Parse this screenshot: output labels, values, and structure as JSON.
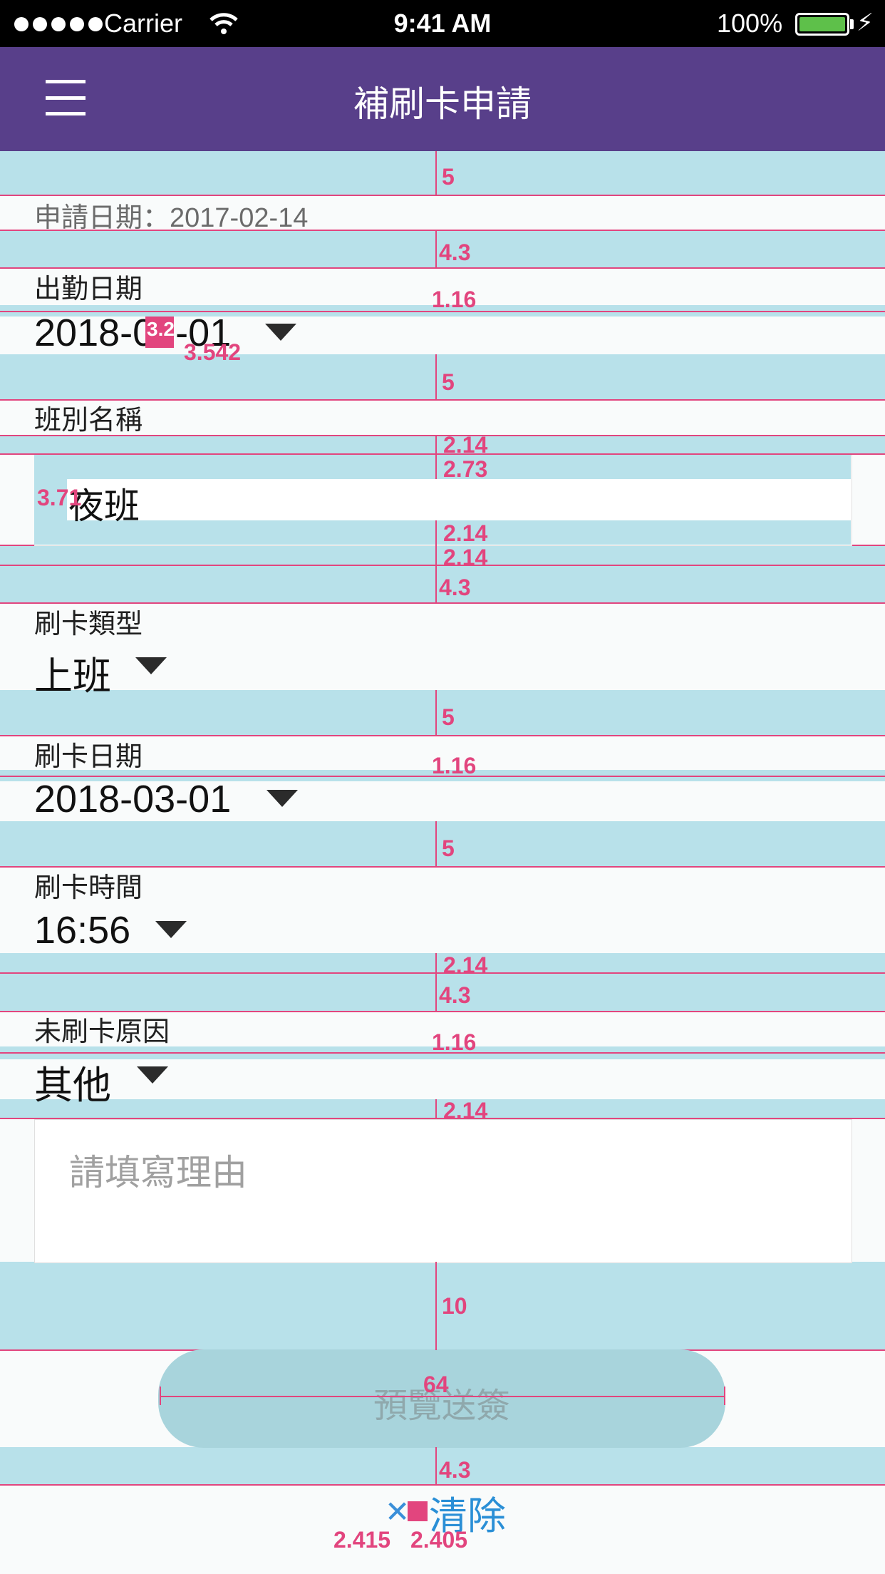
{
  "status_bar": {
    "carrier": "Carrier",
    "time": "9:41 AM",
    "battery": "100%"
  },
  "header": {
    "title": "補刷卡申請"
  },
  "form": {
    "apply_date": "申請日期：2017-02-14",
    "attendance_date": {
      "label": "出勤日期",
      "value": "2018-03-01"
    },
    "shift_name": {
      "label": "班別名稱",
      "value": "夜班"
    },
    "punch_type": {
      "label": "刷卡類型",
      "value": "上班"
    },
    "punch_date": {
      "label": "刷卡日期",
      "value": "2018-03-01"
    },
    "punch_time": {
      "label": "刷卡時間",
      "value": "16:56"
    },
    "reason": {
      "label": "未刷卡原因",
      "value": "其他"
    },
    "reason_text": {
      "placeholder": "請填寫理由"
    }
  },
  "actions": {
    "preview_submit": "預覽送簽",
    "clear": "清除"
  },
  "spec_annotations": {
    "a1": "5",
    "a2": "4.3",
    "a3": "1.16",
    "a4": "3.2",
    "a5": "3.542",
    "a6": "5",
    "a7": "2.14",
    "a8": "2.73",
    "a9": "3.71",
    "a10": "2.14",
    "a11": "2.14",
    "a12": "4.3",
    "a13": "5",
    "a14": "1.16",
    "a15": "5",
    "a16": "2.14",
    "a17": "4.3",
    "a18": "1.16",
    "a19": "2.14",
    "a20": "10",
    "a21": "64",
    "a22": "4.3",
    "a23": "2.415",
    "a24": "2.405"
  },
  "colors": {
    "primary": "#583f8a",
    "overlay": "#b8e1ea",
    "measure": "#e2457e",
    "link": "#2a8fd6"
  }
}
